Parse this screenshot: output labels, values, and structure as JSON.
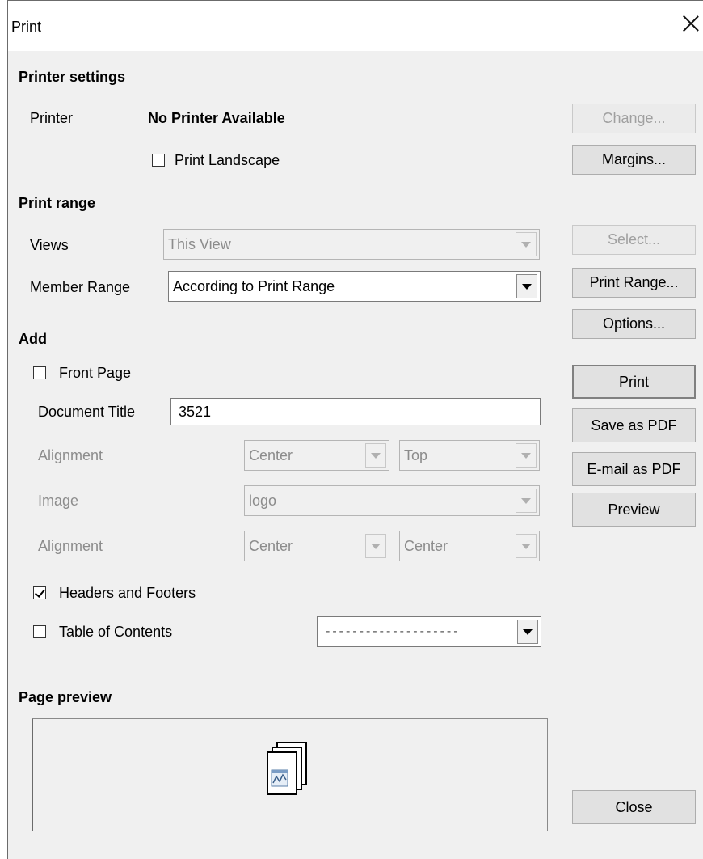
{
  "window": {
    "title": "Print"
  },
  "printer_settings": {
    "heading": "Printer settings",
    "printer_label": "Printer",
    "printer_value": "No Printer Available",
    "landscape_label": "Print Landscape",
    "landscape_checked": false
  },
  "print_range": {
    "heading": "Print range",
    "views_label": "Views",
    "views_value": "This View",
    "member_range_label": "Member Range",
    "member_range_value": "According to Print Range"
  },
  "add": {
    "heading": "Add",
    "front_page_label": "Front Page",
    "front_page_checked": false,
    "document_title_label": "Document Title",
    "document_title_value": "3521",
    "alignment1_label": "Alignment",
    "alignment1_h": "Center",
    "alignment1_v": "Top",
    "image_label": "Image",
    "image_value": "logo",
    "alignment2_label": "Alignment",
    "alignment2_h": "Center",
    "alignment2_v": "Center",
    "headers_footers_label": "Headers and Footers",
    "headers_footers_checked": true,
    "toc_label": "Table of Contents",
    "toc_checked": false,
    "toc_value": "--------------------"
  },
  "page_preview": {
    "heading": "Page preview"
  },
  "buttons": {
    "change": "Change...",
    "margins": "Margins...",
    "select": "Select...",
    "print_range": "Print Range...",
    "options": "Options...",
    "print": "Print",
    "save_pdf": "Save as PDF",
    "email_pdf": "E-mail as PDF",
    "preview": "Preview",
    "close": "Close"
  },
  "icons": {
    "close": "close-icon",
    "document_stack": "document-stack-icon"
  }
}
